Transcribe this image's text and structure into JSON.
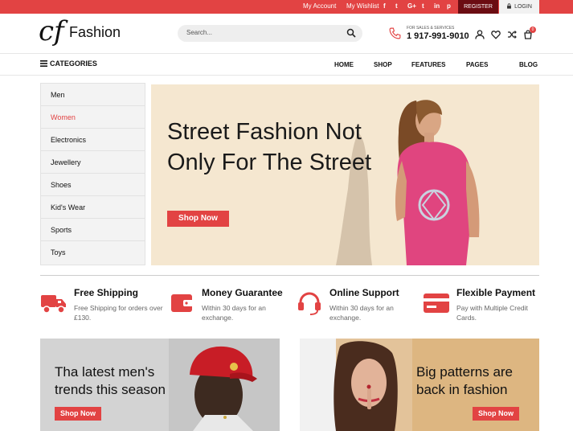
{
  "topbar": {
    "my_account": "My Account",
    "my_wishlist": "My Wishlist",
    "social": [
      "f",
      "t",
      "G+",
      "t",
      "in",
      "p"
    ],
    "register": "REGISTER",
    "login": "LOGIN"
  },
  "header": {
    "logo_mark": "cf",
    "logo_text": "Fashion",
    "search_placeholder": "Search...",
    "phone_caption": "FOR SALES & SERVICES",
    "phone_number": "1 917-991-9010",
    "cart_count": "0"
  },
  "nav": {
    "categories_label": "CATEGORIES",
    "items": [
      "HOME",
      "SHOP",
      "FEATURES",
      "PAGES",
      "BLOG"
    ]
  },
  "sidebar": {
    "items": [
      "Men",
      "Women",
      "Electronics",
      "Jewellery",
      "Shoes",
      "Kid's Wear",
      "Sports",
      "Toys"
    ],
    "active_index": 1
  },
  "hero": {
    "title": "Street Fashion Not Only For The Street",
    "button": "Shop Now"
  },
  "features": [
    {
      "title": "Free Shipping",
      "desc": "Free Shipping for orders over £130.",
      "icon": "truck-icon"
    },
    {
      "title": "Money Guarantee",
      "desc": "Within 30 days for an exchange.",
      "icon": "wallet-icon"
    },
    {
      "title": "Online Support",
      "desc": "Within 30 days for an exchange.",
      "icon": "headset-icon"
    },
    {
      "title": "Flexible Payment",
      "desc": "Pay with Multiple Credit Cards.",
      "icon": "credit-card-icon"
    }
  ],
  "banners": [
    {
      "title": "Tha latest men's trends this season",
      "button": "Shop Now"
    },
    {
      "title": "Big patterns are back in fashion",
      "button": "Shop Now"
    }
  ],
  "colors": {
    "accent": "#e24343",
    "register_bg": "#6b0c12",
    "hero_bg": "#f5e7d0"
  }
}
